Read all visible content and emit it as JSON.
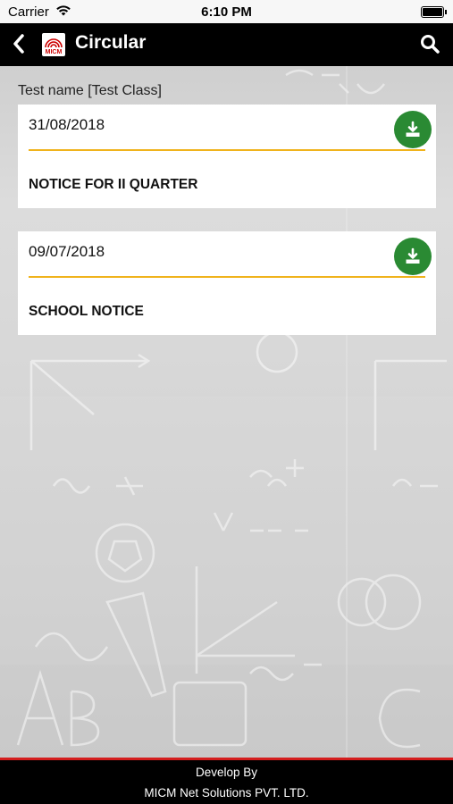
{
  "status_bar": {
    "carrier": "Carrier",
    "time": "6:10 PM"
  },
  "header": {
    "title": "Circular",
    "logo_text": "MICM"
  },
  "class_name": "Test name [Test Class]",
  "circulars": [
    {
      "date": "31/08/2018",
      "title": "NOTICE FOR II QUARTER"
    },
    {
      "date": "09/07/2018",
      "title": "SCHOOL NOTICE"
    }
  ],
  "footer": {
    "line1": "Develop By",
    "line2": "MICM Net Solutions PVT. LTD."
  },
  "colors": {
    "accent_line": "#f0b31c",
    "download_button": "#2a8a33",
    "footer_border": "#d41e1e"
  },
  "icons": {
    "back": "chevron-left-icon",
    "search": "search-icon",
    "download": "download-icon",
    "wifi": "wifi-icon",
    "battery": "battery-icon"
  }
}
